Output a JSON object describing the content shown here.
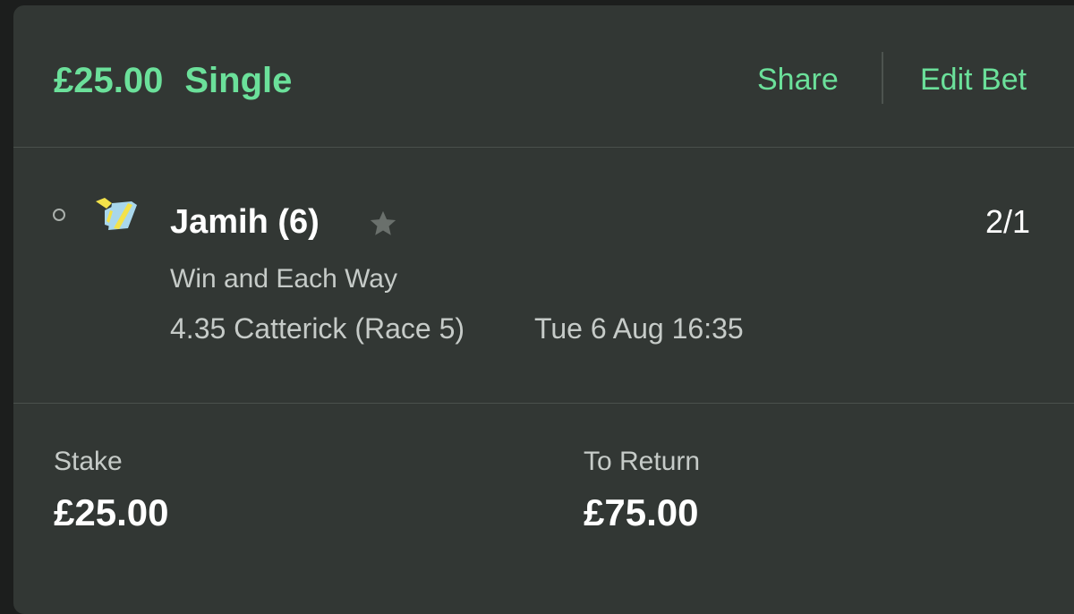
{
  "header": {
    "stake_amount": "£25.00",
    "bet_type": "Single",
    "share_label": "Share",
    "edit_label": "Edit Bet"
  },
  "selection": {
    "runner": "Jamih (6)",
    "odds": "2/1",
    "market": "Win and Each Way",
    "race": "4.35 Catterick (Race 5)",
    "race_datetime": "Tue 6 Aug 16:35",
    "silk_icon": "jockey-silk-icon",
    "favourite_icon": "star-icon"
  },
  "summary": {
    "stake_label": "Stake",
    "stake_value": "£25.00",
    "return_label": "To Return",
    "return_value": "£75.00"
  },
  "colors": {
    "accent": "#6be09a",
    "card_background": "#323734",
    "page_background": "#1c1e1d"
  }
}
